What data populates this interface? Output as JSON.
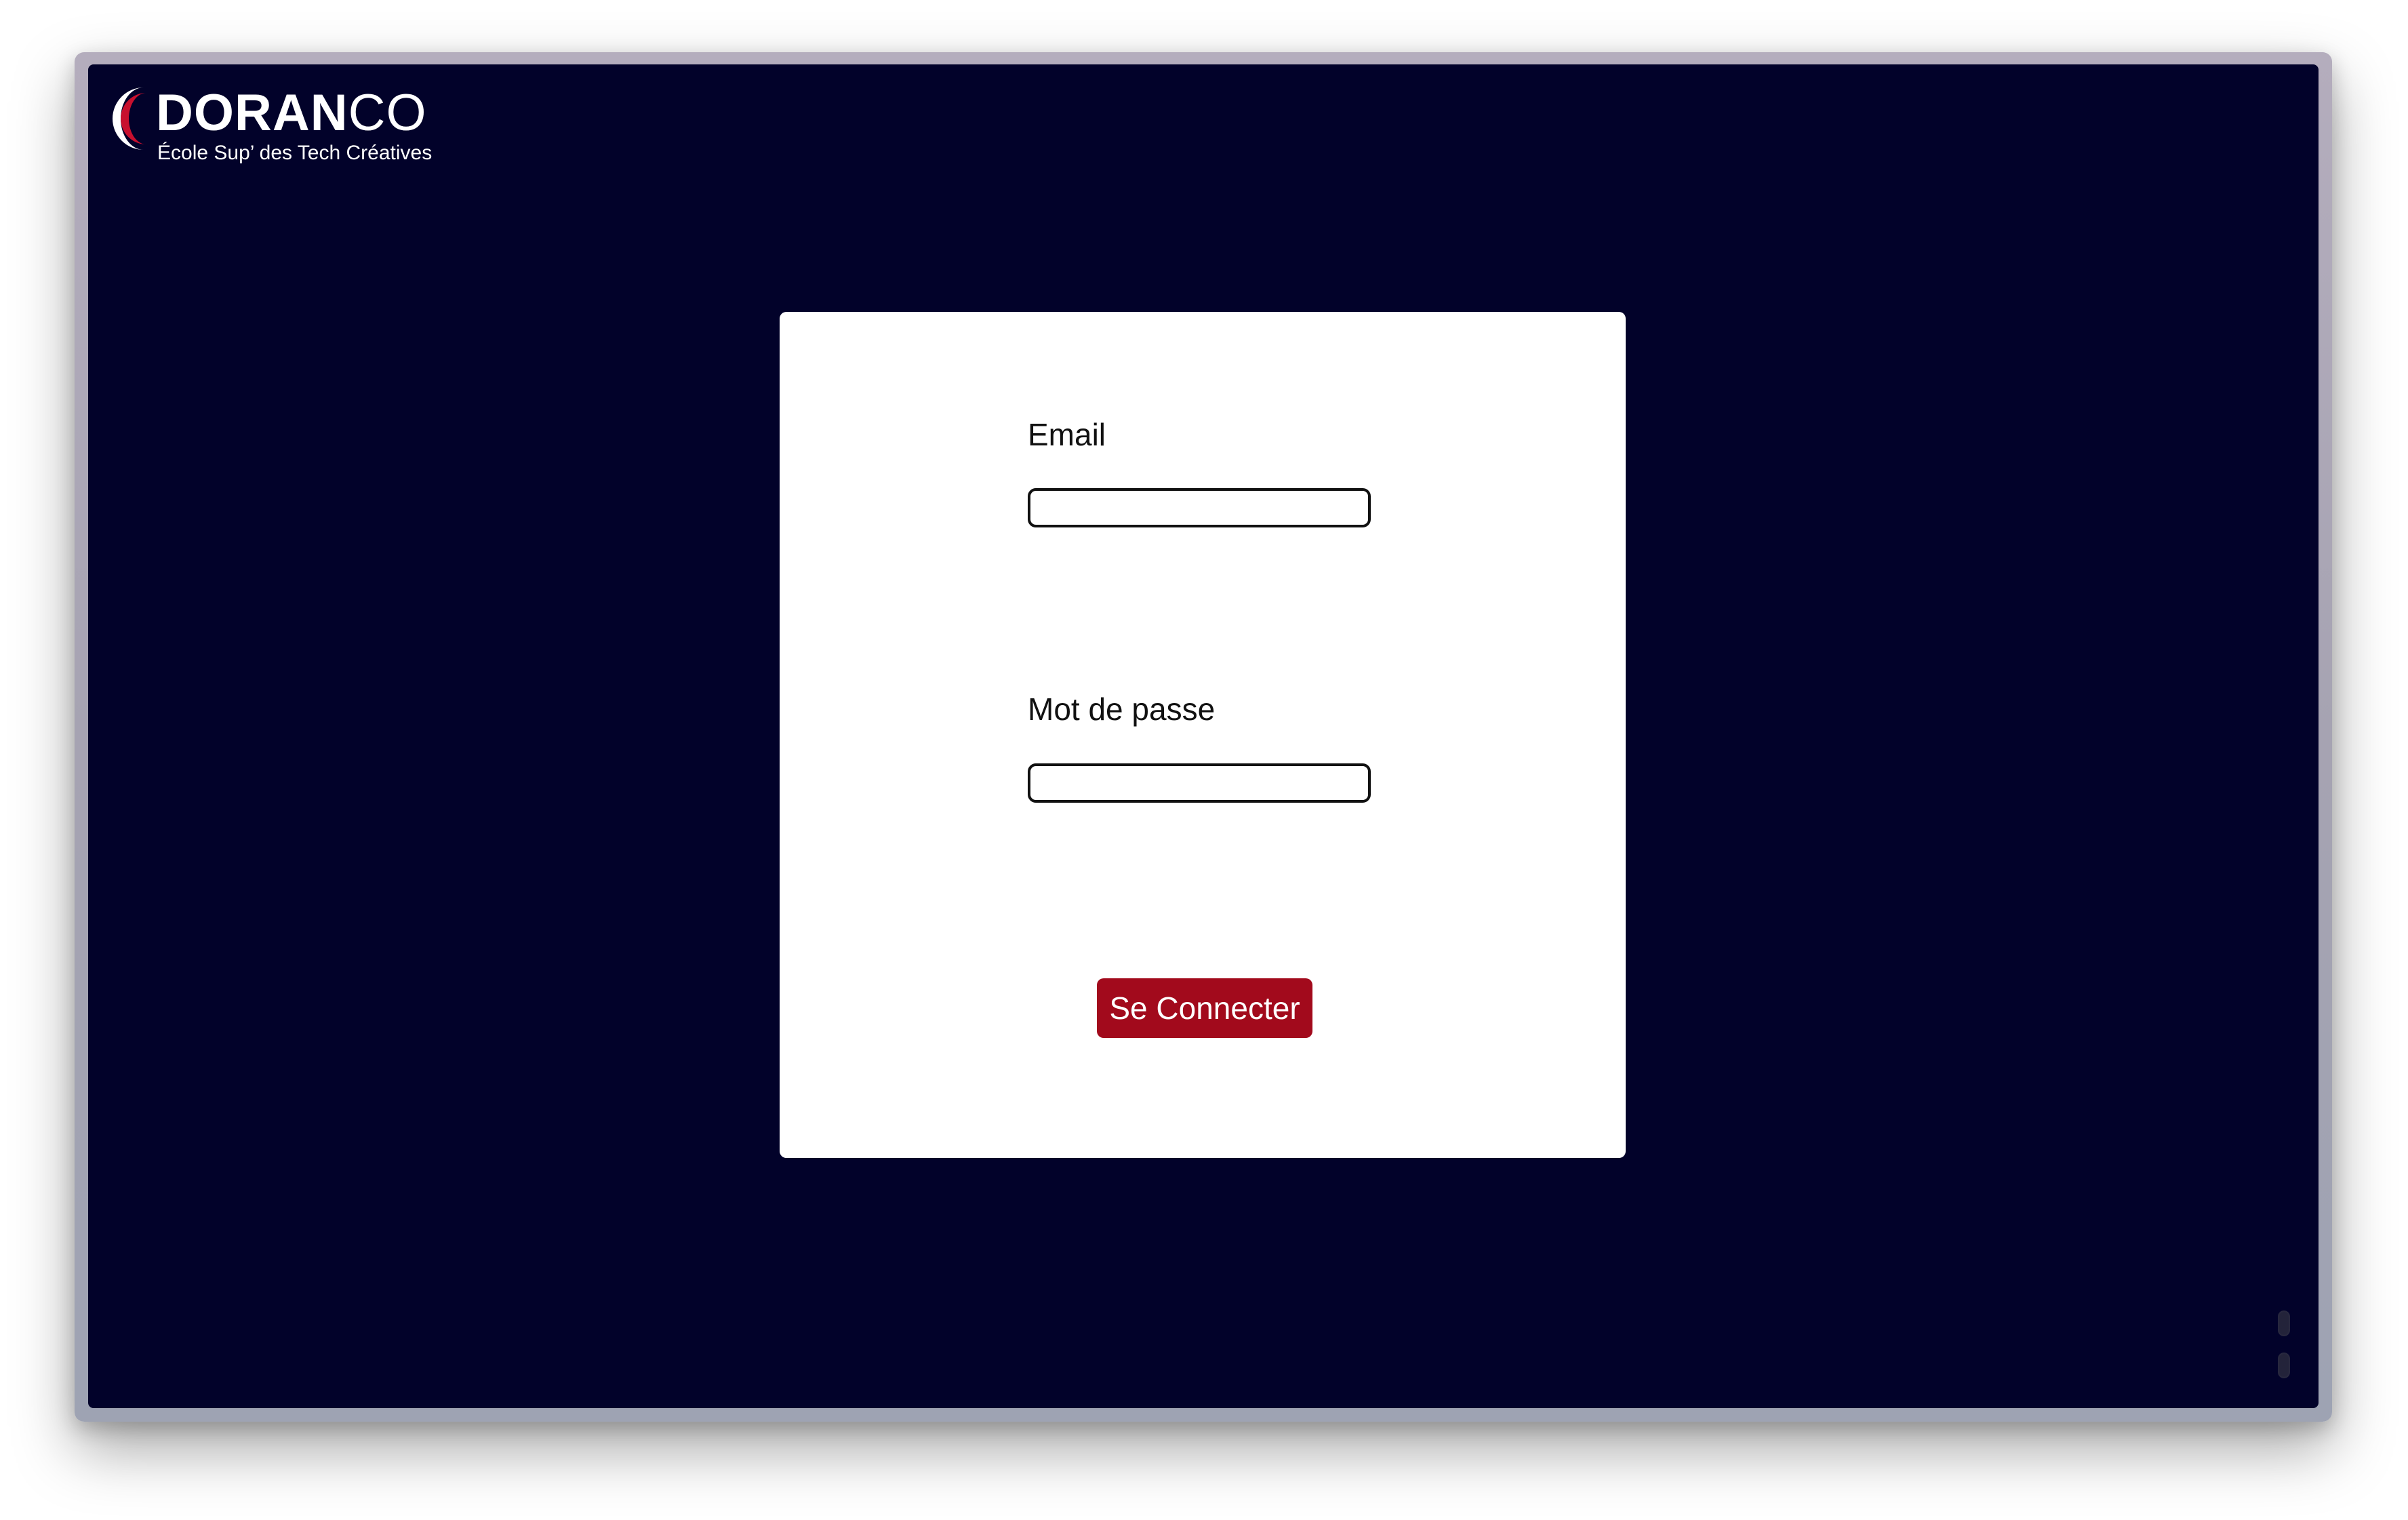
{
  "brand": {
    "name_bold": "DORAN",
    "name_thin": "CO",
    "tagline": "École Sup’ des Tech Créatives",
    "accent_color": "#c8102e",
    "background_color": "#02022a"
  },
  "login_form": {
    "email_label": "Email",
    "email_value": "",
    "password_label": "Mot de passe",
    "password_value": "",
    "submit_label": "Se Connecter",
    "submit_color": "#a20a1c"
  }
}
